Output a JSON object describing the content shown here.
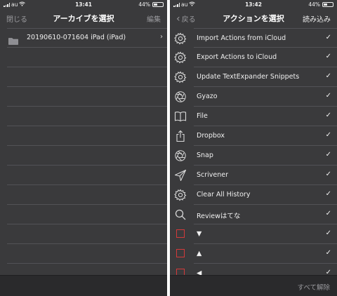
{
  "left": {
    "status": {
      "carrier": "au",
      "time": "13:41",
      "battery": "44%"
    },
    "nav": {
      "left": "閉じる",
      "title": "アーカイブを選択",
      "right": "編集"
    },
    "archives": [
      {
        "label": "20190610-071604 iPad (iPad)"
      }
    ]
  },
  "right": {
    "status": {
      "carrier": "au",
      "time": "13:42",
      "battery": "44%"
    },
    "nav": {
      "back": "戻る",
      "title": "アクションを選択",
      "right": "読み込み"
    },
    "actions": [
      {
        "label": "Import Actions from iCloud",
        "icon": "gear-icon"
      },
      {
        "label": "Export Actions to iCloud",
        "icon": "gear-icon"
      },
      {
        "label": "Update TextExpander Snippets",
        "icon": "gear-icon"
      },
      {
        "label": "Gyazo",
        "icon": "aperture-icon"
      },
      {
        "label": "File",
        "icon": "book-icon"
      },
      {
        "label": "Dropbox",
        "icon": "share-icon"
      },
      {
        "label": "Snap",
        "icon": "aperture-icon"
      },
      {
        "label": "Scrivener",
        "icon": "paper-plane-icon"
      },
      {
        "label": "Clear All History",
        "icon": "gear-icon"
      },
      {
        "label": "Reviewはてな",
        "icon": "search-icon"
      },
      {
        "label": "▼",
        "icon": "red-square-icon"
      },
      {
        "label": "▲",
        "icon": "red-square-icon"
      },
      {
        "label": "◀",
        "icon": "red-square-icon"
      }
    ],
    "check_glyph": "✓",
    "toolbar": {
      "deselect_all": "すべて解除"
    }
  },
  "colors": {
    "panel": "#3a3a3c",
    "separator": "#525256",
    "muted_text": "#9a9a9e",
    "red_accent": "#d43a3a"
  }
}
